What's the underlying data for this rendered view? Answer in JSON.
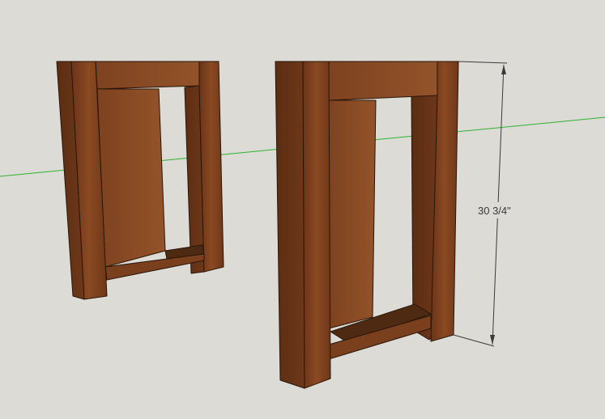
{
  "scene": {
    "background_color": "#dcdbd6",
    "wood_color": "#7a3f1c",
    "wood_dark_color": "#4e2a12",
    "axis_color": "#2db52d",
    "edge_color": "#2a1608"
  },
  "dimension": {
    "label": "30 3/4\""
  }
}
